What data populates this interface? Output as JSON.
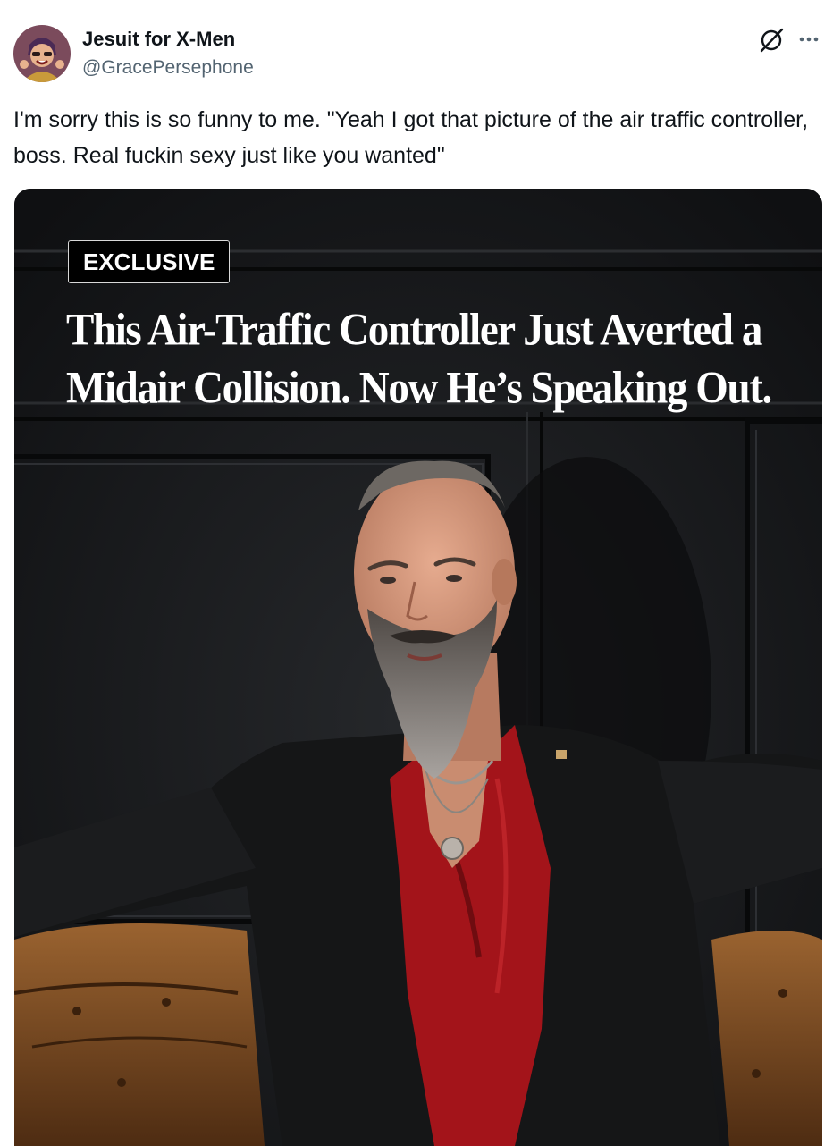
{
  "author": {
    "display_name": "Jesuit for X-Men",
    "handle": "@GracePersephone",
    "avatar_icon": "cartoon-avatar"
  },
  "header_icons": [
    "grok-icon",
    "more-options-icon"
  ],
  "tweet": {
    "text": "I'm sorry this is so funny to me. \"Yeah I got that picture of the air traffic controller, boss. Real fuckin sexy just like you wanted\""
  },
  "media": {
    "badge": "EXCLUSIVE",
    "headline": "This Air-Traffic Controller Just Averted a Midair Collision. Now He’s Speaking Out."
  },
  "colors": {
    "text_primary": "#0f1419",
    "text_secondary": "#536471",
    "shirt_red": "#a3141a",
    "background_dark": "#141517",
    "chair_leather": "#7a4a22"
  }
}
